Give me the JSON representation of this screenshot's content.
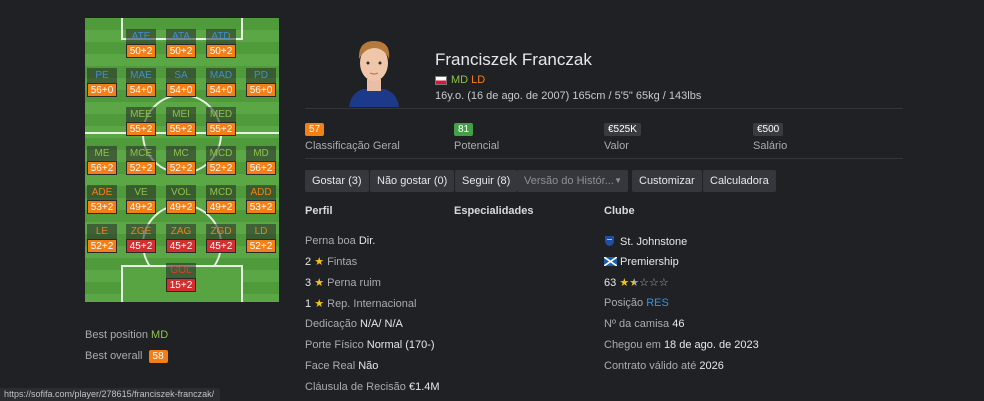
{
  "pitch": {
    "rows": [
      [
        {
          "label": "ATE",
          "value": "50+2",
          "lc": "blue",
          "vc": "orange"
        },
        {
          "label": "ATA",
          "value": "50+2",
          "lc": "blue",
          "vc": "orange"
        },
        {
          "label": "ATD",
          "value": "50+2",
          "lc": "blue",
          "vc": "orange"
        }
      ],
      [
        {
          "label": "PE",
          "value": "56+0",
          "lc": "blue",
          "vc": "orange"
        },
        {
          "label": "MAE",
          "value": "54+0",
          "lc": "blue",
          "vc": "orange"
        },
        {
          "label": "SA",
          "value": "54+0",
          "lc": "blue",
          "vc": "orange"
        },
        {
          "label": "MAD",
          "value": "54+0",
          "lc": "blue",
          "vc": "orange"
        },
        {
          "label": "PD",
          "value": "56+0",
          "lc": "blue",
          "vc": "orange"
        }
      ],
      [
        {
          "label": "MEE",
          "value": "55+2",
          "lc": "green",
          "vc": "orange"
        },
        {
          "label": "MEI",
          "value": "55+2",
          "lc": "green",
          "vc": "orange"
        },
        {
          "label": "MED",
          "value": "55+2",
          "lc": "green",
          "vc": "orange"
        }
      ],
      [
        {
          "label": "ME",
          "value": "56+2",
          "lc": "green",
          "vc": "orange"
        },
        {
          "label": "MCE",
          "value": "52+2",
          "lc": "green",
          "vc": "orange"
        },
        {
          "label": "MC",
          "value": "52+2",
          "lc": "green",
          "vc": "orange"
        },
        {
          "label": "MCD",
          "value": "52+2",
          "lc": "green",
          "vc": "orange"
        },
        {
          "label": "MD",
          "value": "56+2",
          "lc": "green",
          "vc": "orange"
        }
      ],
      [
        {
          "label": "ADE",
          "value": "53+2",
          "lc": "orange",
          "vc": "orange"
        },
        {
          "label": "VE",
          "value": "49+2",
          "lc": "green",
          "vc": "orange"
        },
        {
          "label": "VOL",
          "value": "49+2",
          "lc": "green",
          "vc": "orange"
        },
        {
          "label": "MCD",
          "value": "49+2",
          "lc": "green",
          "vc": "orange"
        },
        {
          "label": "ADD",
          "value": "53+2",
          "lc": "orange",
          "vc": "orange"
        }
      ],
      [
        {
          "label": "LE",
          "value": "52+2",
          "lc": "orange",
          "vc": "orange"
        },
        {
          "label": "ZGE",
          "value": "45+2",
          "lc": "orange",
          "vc": "red"
        },
        {
          "label": "ZAG",
          "value": "45+2",
          "lc": "orange",
          "vc": "red"
        },
        {
          "label": "ZGD",
          "value": "45+2",
          "lc": "orange",
          "vc": "red"
        },
        {
          "label": "LD",
          "value": "52+2",
          "lc": "orange",
          "vc": "orange"
        }
      ],
      [
        {
          "label": "GOL",
          "value": "15+2",
          "lc": "red",
          "vc": "red"
        }
      ]
    ]
  },
  "best": {
    "position_label": "Best position",
    "position_value": "MD",
    "overall_label": "Best overall",
    "overall_value": "58"
  },
  "status_url": "https://sofifa.com/player/278615/franciszek-franczak/",
  "player": {
    "name": "Franciszek Franczak",
    "pos1": "MD",
    "pos2": "LD",
    "info": "16y.o. (16 de ago. de 2007) 165cm / 5'5\" 65kg / 143lbs"
  },
  "stats": [
    {
      "value": "57",
      "label": "Classificação Geral",
      "color": "#f57f17"
    },
    {
      "value": "81",
      "label": "Potencial",
      "color": "#43a047"
    },
    {
      "value": "€525K",
      "label": "Valor",
      "color": "#3a3b40"
    },
    {
      "value": "€500",
      "label": "Salário",
      "color": "#3a3b40"
    }
  ],
  "buttons": {
    "like": "Gostar (3)",
    "dislike": "Não gostar (0)",
    "follow": "Seguir (8)",
    "version": "Versão do Histór...",
    "customize": "Customizar",
    "calculator": "Calculadora"
  },
  "profile": {
    "heading": "Perfil",
    "preferred_foot_label": "Perna boa",
    "preferred_foot_value": "Dir.",
    "skill_moves_value": "2",
    "skill_moves_label": "Fintas",
    "weak_foot_value": "3",
    "weak_foot_label": "Perna ruim",
    "reputation_value": "1",
    "reputation_label": "Rep. Internacional",
    "work_rate_label": "Dedicação",
    "work_rate_value": "N/A/ N/A",
    "body_type_label": "Porte Físico",
    "body_type_value": "Normal (170-)",
    "real_face_label": "Face Real",
    "real_face_value": "Não",
    "release_label": "Cláusula de Recisão",
    "release_value": "€1.4M"
  },
  "specialities": {
    "heading": "Especialidades"
  },
  "club": {
    "heading": "Clube",
    "name": "St. Johnstone",
    "league": "Premiership",
    "rating": "63",
    "rating_stars": 1.5,
    "position_label": "Posição",
    "position_value": "RES",
    "jersey_label": "Nº da camisa",
    "jersey_value": "46",
    "joined_label": "Chegou em",
    "joined_value": "18 de ago. de 2023",
    "contract_label": "Contrato válido até",
    "contract_value": "2026"
  }
}
